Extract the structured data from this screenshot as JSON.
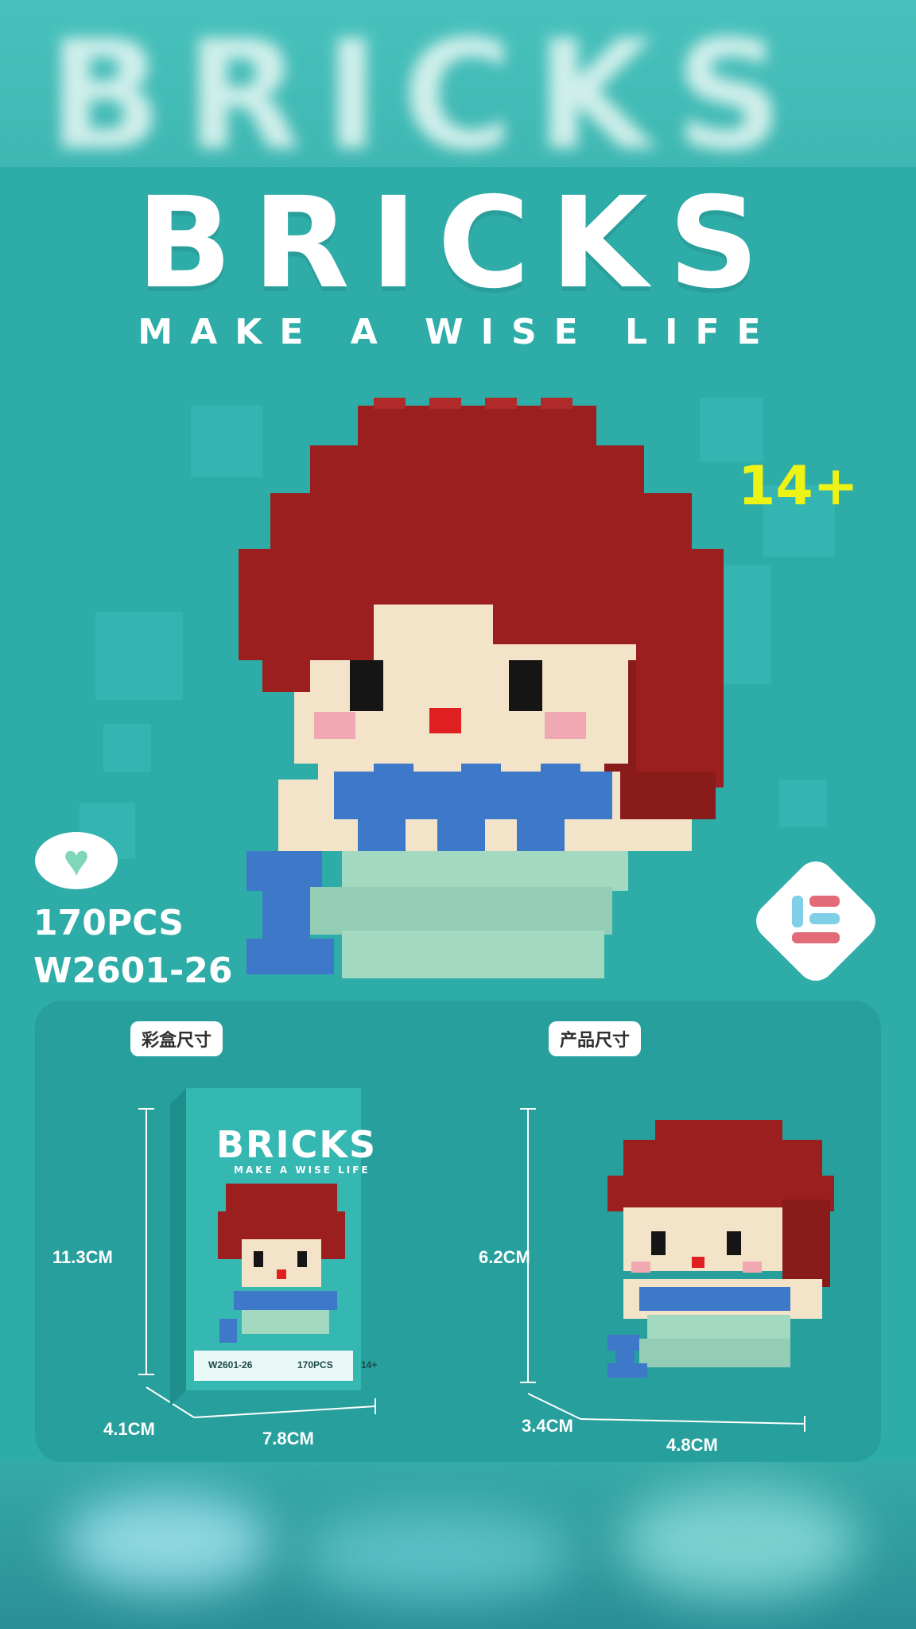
{
  "top_blur_text": "BRICKS",
  "brand": {
    "title": "BRICKS",
    "subtitle": "MAKE A WISE LIFE"
  },
  "age_rating": "14+",
  "piece_count": "170PCS",
  "model_code": "W2601-26",
  "color_box": {
    "label": "彩盒尺寸",
    "height": "11.3CM",
    "depth": "4.1CM",
    "width": "7.8CM",
    "box_title": "BRICKS",
    "box_subtitle": "MAKE A WISE LIFE",
    "box_code": "W2601-26",
    "box_pcs": "170PCS",
    "box_age": "14+"
  },
  "product": {
    "label": "产品尺寸",
    "height": "6.2CM",
    "depth": "3.4CM",
    "width": "4.8CM"
  },
  "colors": {
    "background": "#2eaca8",
    "hair": "#9b1f1f",
    "skin": "#f3e3c8",
    "top": "#3d78c9",
    "tail": "#a3d8c1",
    "age_text": "#ecf315"
  },
  "icons": [
    "heart-icon",
    "brand-logo-icon",
    "lego-mermaid-figure"
  ]
}
